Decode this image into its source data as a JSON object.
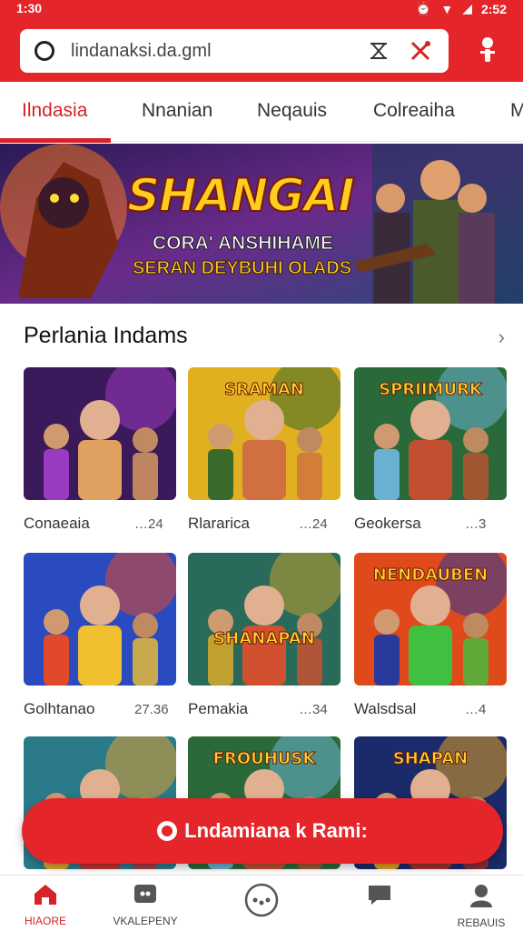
{
  "status_bar": {
    "time": "1:30",
    "battery": "2:52"
  },
  "address_bar": {
    "url": "lindanaksi.da.gml"
  },
  "tabs": [
    {
      "label": "Ilndasia",
      "active": true
    },
    {
      "label": "Nnanian",
      "active": false
    },
    {
      "label": "Neqauis",
      "active": false
    },
    {
      "label": "Colreaiha",
      "active": false
    },
    {
      "label": "M",
      "active": false
    }
  ],
  "banner": {
    "title": "SHANGAI",
    "line1": "CORA' ANSHIHAME",
    "line2": "SERAN DEYBUHI OLADS"
  },
  "section": {
    "title": "Perlania Indams",
    "arrow": "›"
  },
  "games": [
    {
      "name": "Conaeaia",
      "meta": "…24",
      "art": "purple",
      "banner": ""
    },
    {
      "name": "Rlararica",
      "meta": "…24",
      "art": "yellow",
      "banner": "SRAMAN"
    },
    {
      "name": "Geokersa",
      "meta": "…3",
      "art": "jungle",
      "banner": "SPRIIMURK"
    },
    {
      "name": "Golhtanao",
      "meta": "27.36",
      "art": "blue",
      "banner": ""
    },
    {
      "name": "Pemakia",
      "meta": "…34",
      "art": "green",
      "banner": "SHANAPAN"
    },
    {
      "name": "Walsdsal",
      "meta": "…4",
      "art": "red",
      "banner": "NENDAUBEN"
    },
    {
      "name": "",
      "meta": "",
      "art": "teal",
      "banner": ""
    },
    {
      "name": "",
      "meta": "",
      "art": "jungle",
      "banner": "FROUHUSK"
    },
    {
      "name": "",
      "meta": "",
      "art": "navy",
      "banner": "SHAPAN"
    }
  ],
  "cta": {
    "label": "Lndamiana k Rami:"
  },
  "bottom_nav": [
    {
      "label": "HIAORE",
      "icon": "home-icon",
      "active": true
    },
    {
      "label": "VKALEPENY",
      "icon": "chat-icon",
      "active": false
    },
    {
      "label": "",
      "icon": "more-icon",
      "active": false
    },
    {
      "label": "",
      "icon": "message-icon",
      "active": false
    },
    {
      "label": "REBAUIS",
      "icon": "profile-icon",
      "active": false
    }
  ],
  "colors": {
    "accent": "#e4262a",
    "active_text": "#d52327"
  }
}
